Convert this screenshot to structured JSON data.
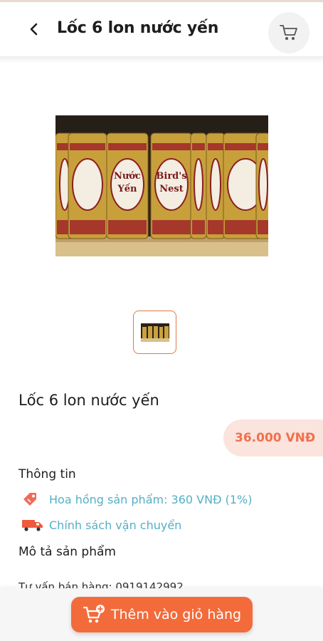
{
  "header": {
    "title": "Lốc 6 lon nước yến",
    "back_icon": "chevron-left-icon",
    "cart_icon": "shopping-cart-icon"
  },
  "product": {
    "name": "Lốc 6 lon nước yến",
    "price": "36.000 VNĐ",
    "image_can_labels": [
      "Nước Yến",
      "Bird's Nest"
    ]
  },
  "info": {
    "section_title": "Thông tin",
    "commission": "Hoa hồng sản phẩm: 360 VNĐ (1%)",
    "commission_icon": "tag-icon",
    "shipping": "Chính sách vận chuyển",
    "shipping_icon": "truck-icon"
  },
  "description": {
    "section_title": "Mô tả sản phẩm",
    "text": "Tư vấn bán hàng: 0919142992"
  },
  "actions": {
    "add_to_cart": "Thêm vào giỏ hàng",
    "add_to_cart_icon": "cart-plus-icon"
  },
  "colors": {
    "accent": "#f36b3b",
    "price_text": "#f0714c",
    "price_bg": "#fbe3de",
    "link": "#55afc6"
  }
}
